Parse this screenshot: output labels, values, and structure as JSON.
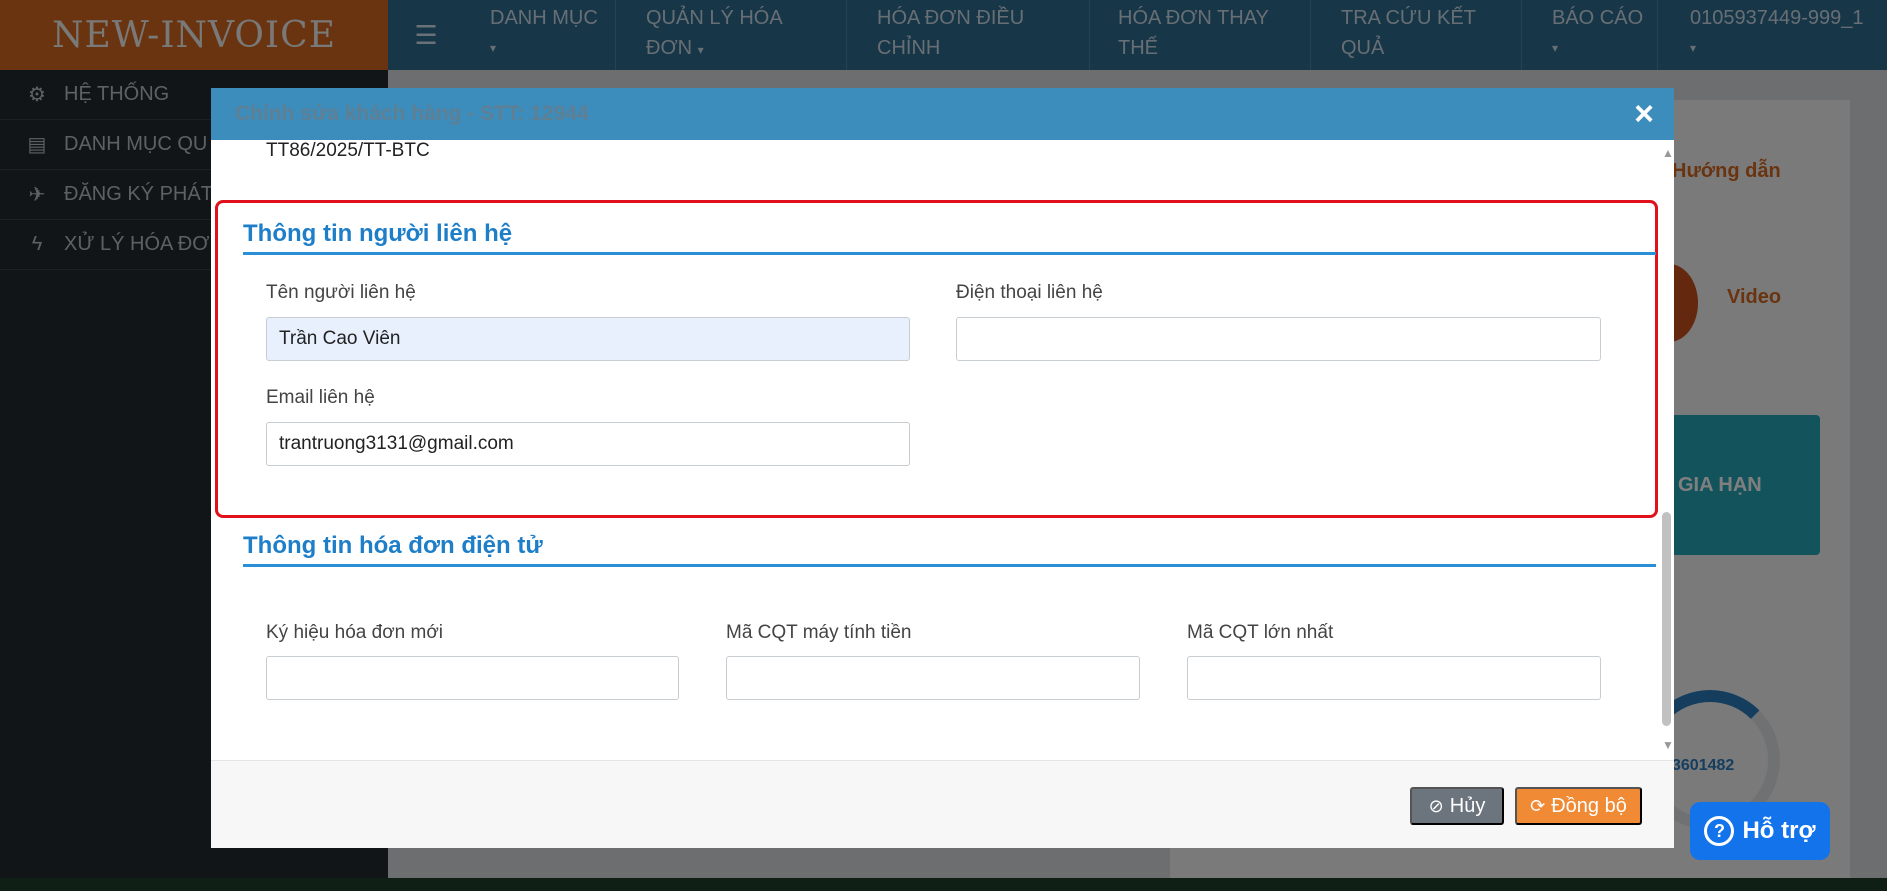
{
  "app": {
    "logo": "NEW-INVOICE"
  },
  "nav": {
    "items": [
      {
        "label": "DANH MỤC",
        "caret": "▾"
      },
      {
        "label": "QUẢN LÝ HÓA ĐƠN",
        "caret": "▾"
      },
      {
        "label": "HÓA ĐƠN ĐIỀU CHỈNH",
        "caret": ""
      },
      {
        "label": "HÓA ĐƠN THAY THẾ",
        "caret": ""
      },
      {
        "label": "TRA CỨU KẾT QUẢ",
        "caret": ""
      },
      {
        "label": "BÁO CÁO",
        "caret": "▾"
      },
      {
        "label": "0105937449-999_1",
        "caret": "▾"
      }
    ]
  },
  "sidebar": {
    "items": [
      {
        "label": "HỆ THỐNG",
        "icon": "gears-icon"
      },
      {
        "label": "DANH MỤC QU",
        "icon": "file-icon"
      },
      {
        "label": "ĐĂNG KÝ PHÁT",
        "icon": "plane-icon"
      },
      {
        "label": "XỬ LÝ HÓA ĐƠ",
        "icon": "bolt-icon"
      }
    ]
  },
  "background": {
    "guide": "Hướng dẫn",
    "video": "Video",
    "renew": "GIA HẠN",
    "number": "3601482"
  },
  "modal": {
    "title": "Chỉnh sửa khách hàng - STT: 12944",
    "close": "×",
    "prev_text": "TT86/2025/TT-BTC",
    "contact": {
      "title": "Thông tin người liên hệ",
      "name_label": "Tên người liên hệ",
      "name_value": "Trần Cao Viên",
      "phone_label": "Điện thoại liên hệ",
      "phone_value": "",
      "email_label": "Email liên hệ",
      "email_value": "trantruong3131@gmail.com"
    },
    "einvoice": {
      "title": "Thông tin hóa đơn điện tử",
      "symbol_label": "Ký hiệu hóa đơn mới",
      "symbol_value": "",
      "cqt_pos_label": "Mã CQT máy tính tiền",
      "cqt_pos_value": "",
      "cqt_max_label": "Mã CQT lớn nhất",
      "cqt_max_value": ""
    },
    "footer": {
      "cancel_label": "Hủy",
      "sync_label": "Đồng bộ"
    }
  },
  "support": {
    "label": "Hỗ trợ"
  },
  "colors": {
    "header": "#3c8dbc",
    "logo_bg": "#d2691e",
    "section_title": "#1e7fc8",
    "highlight_border": "#e0111b",
    "sync_button": "#f08a34",
    "cancel_button": "#6c757d"
  }
}
